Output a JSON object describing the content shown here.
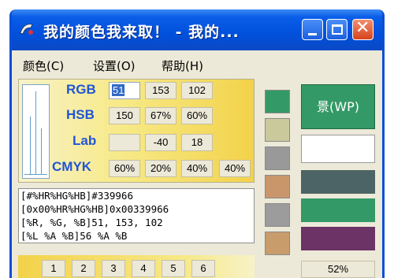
{
  "window": {
    "title": "我的颜色我来取！ - 我的...",
    "controls": {
      "minimize_icon": "minimize-icon",
      "maximize_icon": "maximize-icon",
      "close_icon": "close-icon",
      "close_glyph": "✕"
    }
  },
  "menu": [
    {
      "label": "颜色(C)"
    },
    {
      "label": "设置(O)"
    },
    {
      "label": "帮助(H)"
    }
  ],
  "color_rows": {
    "rgb": {
      "label": "RGB",
      "values": [
        "51",
        "153",
        "102"
      ]
    },
    "hsb": {
      "label": "HSB",
      "values": [
        "150",
        "67%",
        "60%"
      ]
    },
    "lab": {
      "label": "Lab",
      "values": [
        "",
        "-40",
        "18"
      ]
    },
    "cmyk": {
      "label": "CMYK",
      "values": [
        "60%",
        "20%",
        "40%",
        "40%"
      ]
    }
  },
  "formats": [
    "[#%HR%HG%HB]#339966",
    "[0x00%HR%HG%HB]0x00339966",
    "[%R, %G, %B]51, 153, 102",
    "[%L %A %B]56 %A %B"
  ],
  "number_buttons": [
    "1",
    "2",
    "3",
    "4",
    "5",
    "6"
  ],
  "swatches": [
    "#339966",
    "#c9c99b",
    "#999999",
    "#c9966b",
    "#9c9c9c",
    "#c99c6b"
  ],
  "preview": {
    "label": "景(WP)",
    "color": "#339966",
    "bars": [
      "#4d6466",
      "#339966",
      "#6b3366"
    ],
    "zoom": "52%"
  },
  "colors": {
    "accent": "#2155d6",
    "titlebar": "#0a5ee8"
  }
}
